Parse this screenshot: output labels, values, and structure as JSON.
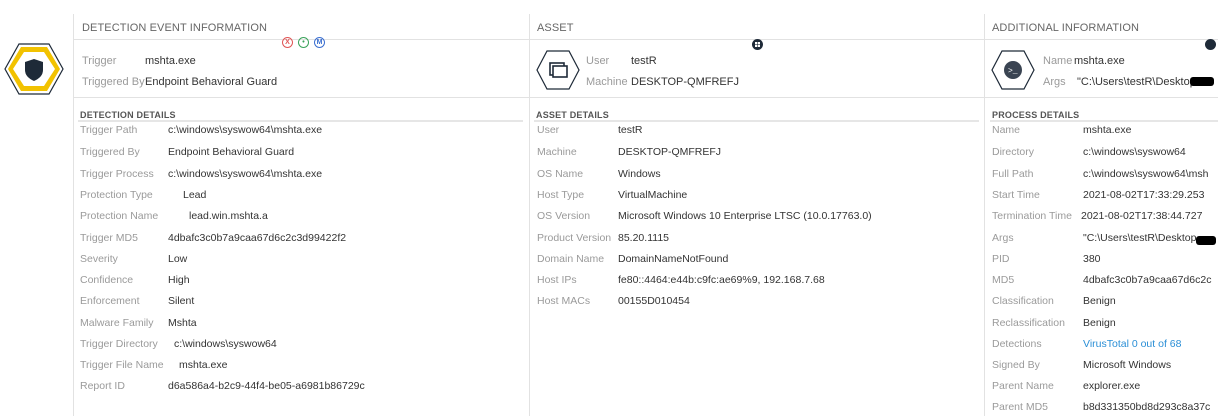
{
  "header": {
    "detection_event": "DETECTION EVENT INFORMATION",
    "asset": "ASSET",
    "additional": "ADDITIONAL INFORMATION"
  },
  "summary": {
    "trigger_label": "Trigger",
    "trigger_value": "mshta.exe",
    "triggered_by_label": "Triggered By",
    "triggered_by_value": "Endpoint Behavioral Guard",
    "user_label": "User",
    "user_value": "testR",
    "machine_label": "Machine",
    "machine_value": "DESKTOP-QMFREFJ",
    "name_label": "Name",
    "name_value": "mshta.exe",
    "args_label": "Args",
    "args_value": "\"C:\\Users\\testR\\Desktop"
  },
  "detection_details": {
    "title": "DETECTION DETAILS",
    "rows": [
      {
        "label": "Trigger Path",
        "value": "c:\\windows\\syswow64\\mshta.exe"
      },
      {
        "label": "Triggered By",
        "value": "Endpoint Behavioral Guard"
      },
      {
        "label": "Trigger Process",
        "value": "c:\\windows\\syswow64\\mshta.exe"
      },
      {
        "label": "Protection Type",
        "value": "Lead"
      },
      {
        "label": "Protection Name",
        "value": "lead.win.mshta.a"
      },
      {
        "label": "Trigger MD5",
        "value": "4dbafc3c0b7a9caa67d6c2c3d99422f2"
      },
      {
        "label": "Severity",
        "value": "Low"
      },
      {
        "label": "Confidence",
        "value": "High"
      },
      {
        "label": "Enforcement",
        "value": "Silent"
      },
      {
        "label": "Malware Family",
        "value": "Mshta"
      },
      {
        "label": "Trigger Directory",
        "value": "c:\\windows\\syswow64"
      },
      {
        "label": "Trigger File Name",
        "value": "mshta.exe"
      },
      {
        "label": "Report ID",
        "value": "d6a586a4-b2c9-44f4-be05-a6981b86729c"
      }
    ]
  },
  "asset_details": {
    "title": "ASSET DETAILS",
    "rows": [
      {
        "label": "User",
        "value": "testR"
      },
      {
        "label": "Machine",
        "value": "DESKTOP-QMFREFJ"
      },
      {
        "label": "OS Name",
        "value": "Windows"
      },
      {
        "label": "Host Type",
        "value": "VirtualMachine"
      },
      {
        "label": "OS Version",
        "value": "Microsoft Windows 10 Enterprise LTSC (10.0.17763.0)"
      },
      {
        "label": "Product Version",
        "value": "85.20.1115"
      },
      {
        "label": "Domain Name",
        "value": "DomainNameNotFound"
      },
      {
        "label": "Host IPs",
        "value": "fe80::4464:e44b:c9fc:ae69%9, 192.168.7.68"
      },
      {
        "label": "Host MACs",
        "value": "00155D010454"
      }
    ]
  },
  "process_details": {
    "title": "PROCESS DETAILS",
    "rows": [
      {
        "label": "Name",
        "value": "mshta.exe"
      },
      {
        "label": "Directory",
        "value": "c:\\windows\\syswow64"
      },
      {
        "label": "Full Path",
        "value": "c:\\windows\\syswow64\\msh"
      },
      {
        "label": "Start Time",
        "value": "2021-08-02T17:33:29.253"
      },
      {
        "label": "Termination Time",
        "value": "2021-08-02T17:38:44.727"
      },
      {
        "label": "Args",
        "value": "\"C:\\Users\\testR\\Desktop"
      },
      {
        "label": "PID",
        "value": "380"
      },
      {
        "label": "MD5",
        "value": "4dbafc3c0b7a9caa67d6c2c"
      },
      {
        "label": "Classification",
        "value": "Benign"
      },
      {
        "label": "Reclassification",
        "value": "Benign"
      },
      {
        "label": "Detections",
        "value": "VirusTotal 0 out of 68"
      },
      {
        "label": "Signed By",
        "value": "Microsoft Windows"
      },
      {
        "label": "Parent Name",
        "value": "explorer.exe"
      },
      {
        "label": "Parent MD5",
        "value": "b8d331350bd8d293c8a37c"
      }
    ]
  },
  "colors": {
    "shield_ring": "#f2c200",
    "shield_body": "#1e2a38",
    "link": "#2b8fd6",
    "badge_red": "#e05555",
    "badge_green": "#3aa35a",
    "badge_blue": "#3b6fd0"
  },
  "badges": {
    "red": "X",
    "green": "•",
    "blue": "M"
  },
  "icons": {
    "shield": "shield-icon",
    "asset": "monitor-icon",
    "process": "terminal-icon",
    "windows": "windows-icon"
  }
}
